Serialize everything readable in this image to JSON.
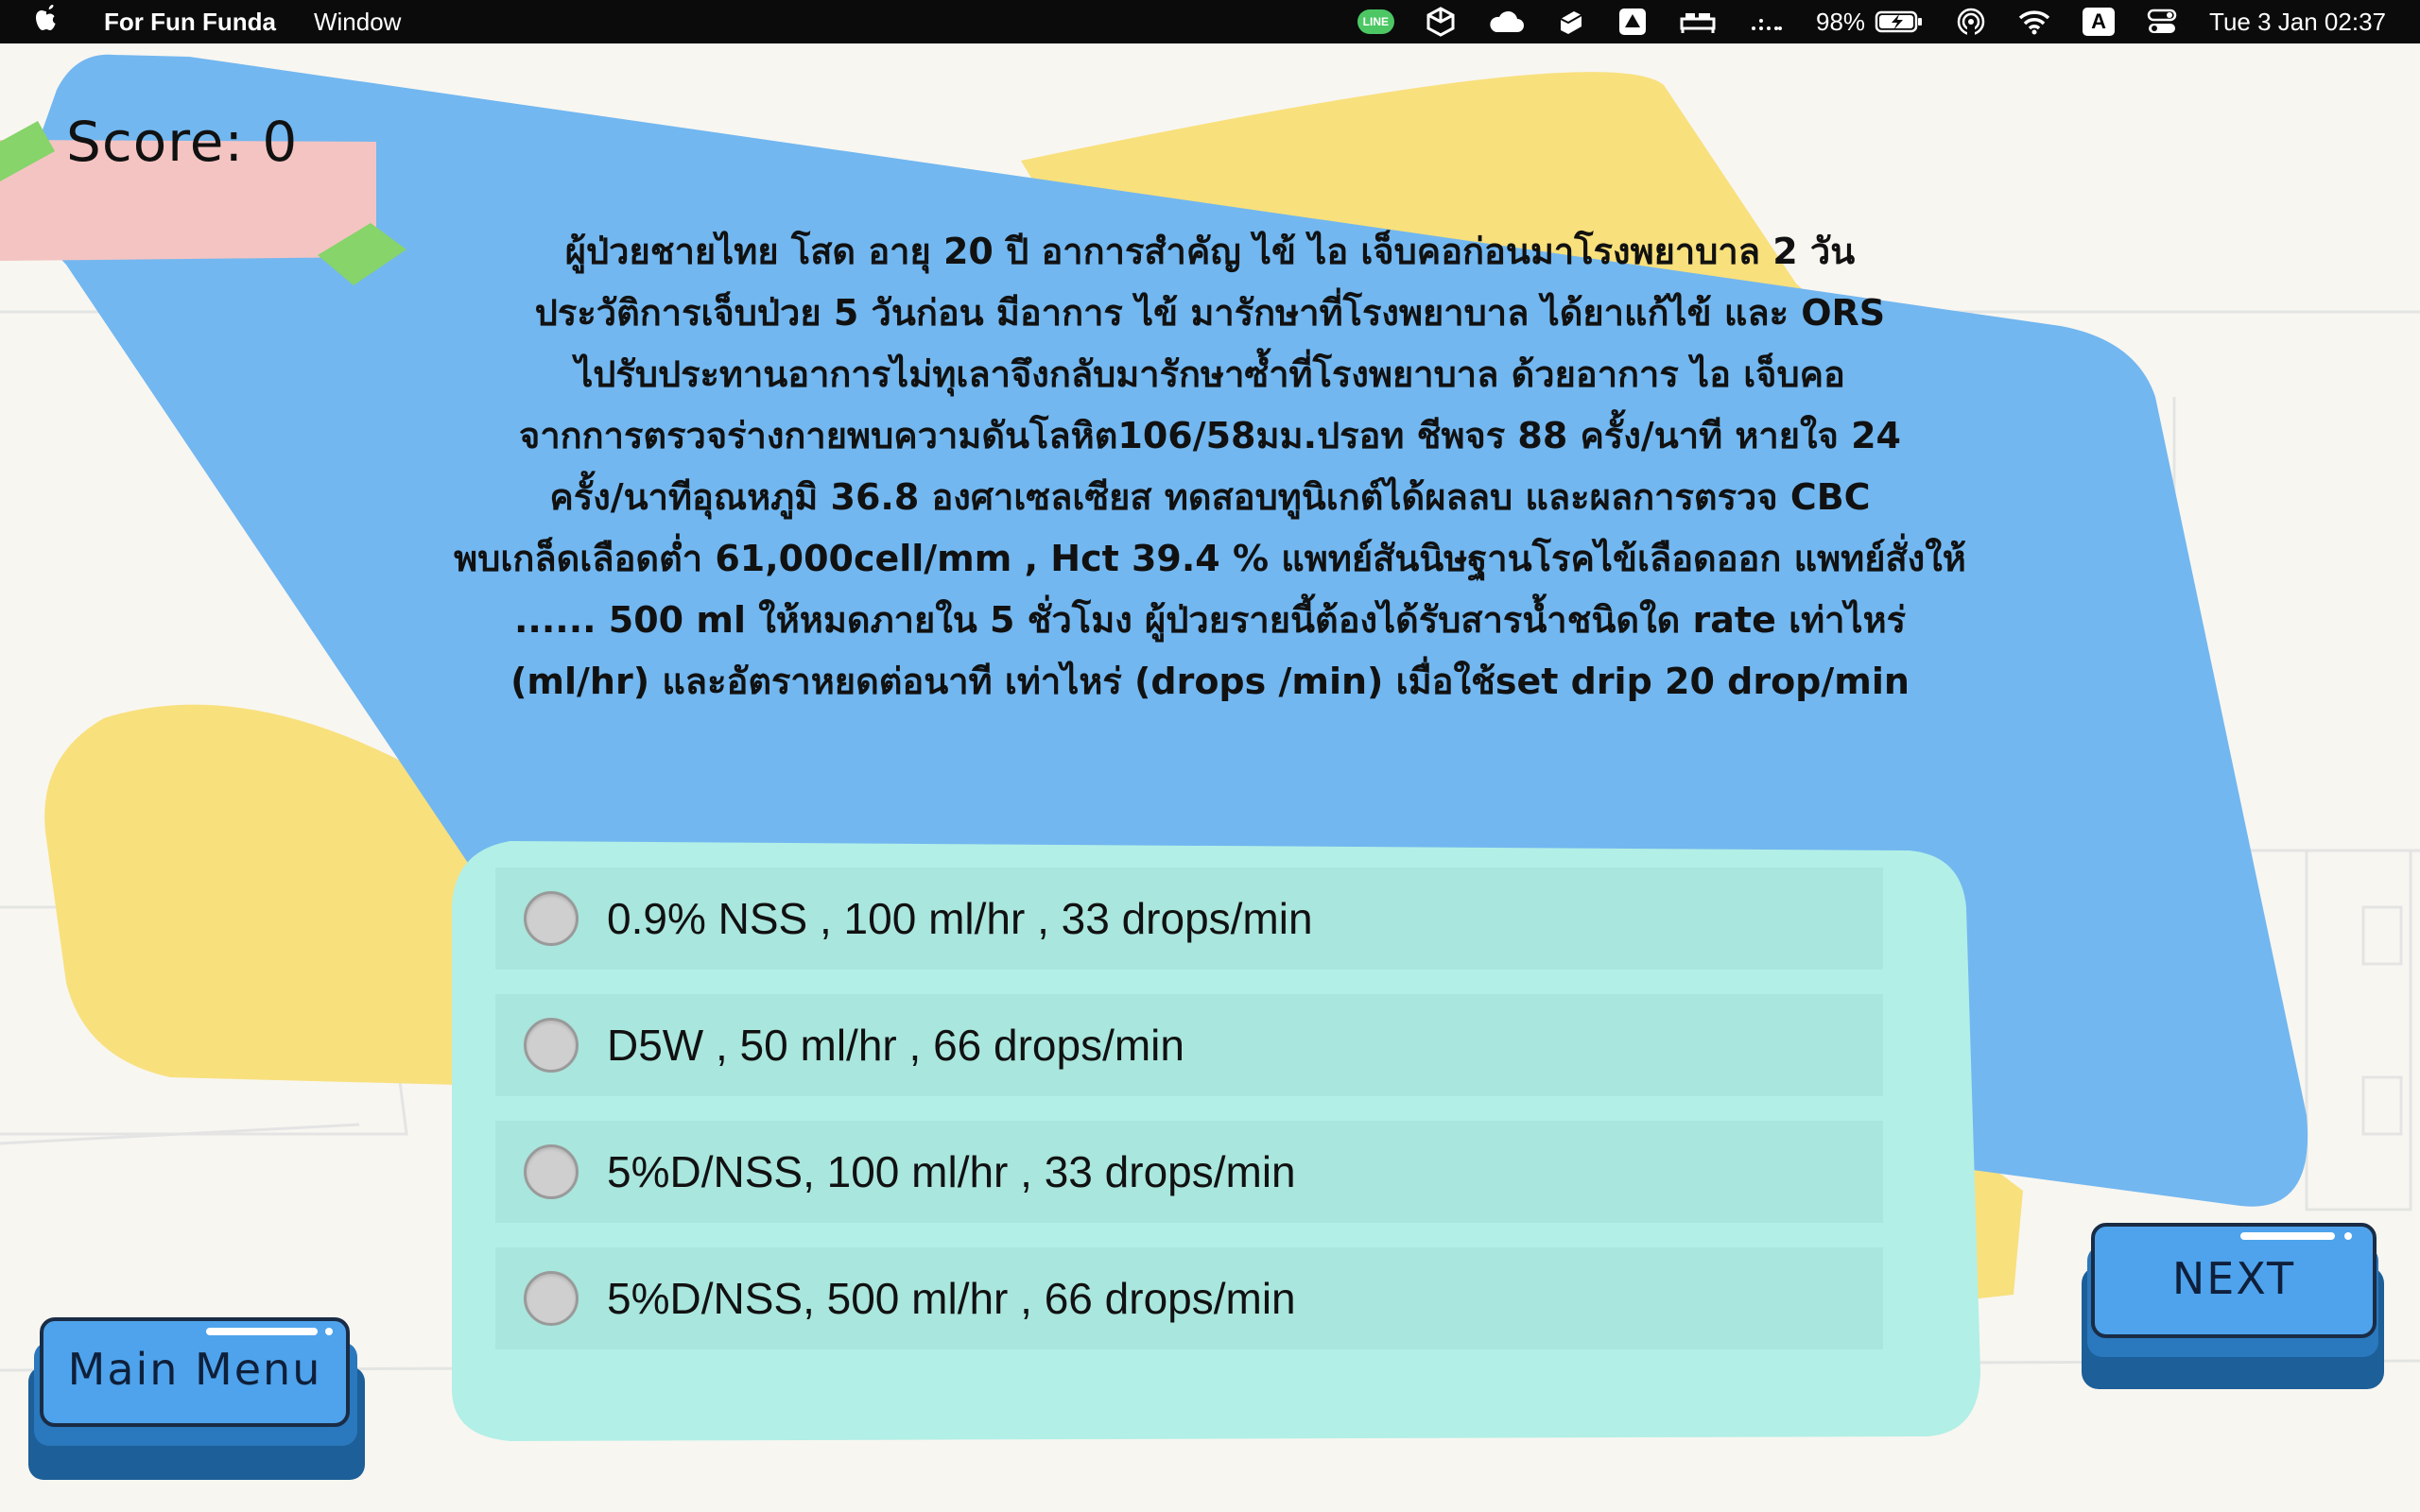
{
  "menubar": {
    "app_name": "For Fun Funda",
    "menu_window": "Window",
    "line_label": "LINE",
    "battery_percent": "98%",
    "input_source": "A",
    "clock": "Tue 3 Jan  02:37"
  },
  "game": {
    "score_text": "Score: 0",
    "question": "ผู้ป่วยชายไทย โสด อายุ 20 ปี อาการสำคัญ ไข้ ไอ เจ็บคอก่อนมาโรงพยาบาล 2 วัน\nประวัติการเจ็บป่วย 5 วันก่อน มีอาการ ไข้ มารักษาที่โรงพยาบาล ได้ยาแก้ไข้ และ ORS\nไปรับประทานอาการไม่ทุเลาจึงกลับมารักษาซ้ำที่โรงพยาบาล ด้วยอาการ ไอ เจ็บคอ\nจากการตรวจร่างกายพบความดันโลหิต106/58มม.ปรอท ชีพจร 88 ครั้ง/นาที หายใจ 24\nครั้ง/นาทีอุณหภูมิ 36.8 องศาเซลเซียส ทดสอบทูนิเกต์ได้ผลลบ และผลการตรวจ CBC\nพบเกล็ดเลือดต่ำ 61,000cell/mm , Hct 39.4 % แพทย์สันนิษฐานโรคไข้เลือดออก แพทย์สั่งให้\n......  500 ml ให้หมดภายใน 5 ชั่วโมง  ผู้ป่วยรายนี้ต้องได้รับสารน้ำชนิดใด rate เท่าไหร่\n(ml/hr) และอัตราหยดต่อนาที เท่าไหร่ (drops /min) เมื่อใช้set drip 20 drop/min",
    "options": [
      {
        "label": "0.9% NSS , 100 ml/hr ,  33 drops/min"
      },
      {
        "label": "D5W , 50 ml/hr , 66 drops/min"
      },
      {
        "label": "5%D/NSS, 100 ml/hr , 33 drops/min"
      },
      {
        "label": "5%D/NSS, 500 ml/hr , 66 drops/min"
      }
    ],
    "next_label": "NEXT",
    "main_menu_label": "Main  Menu"
  },
  "colors": {
    "blue_panel": "#72b7f0",
    "yellow_shape": "#f8e07d",
    "answer_panel": "#b2efe6",
    "option_row": "#a9e6dd",
    "score_tag": "#f4c4c2",
    "tape": "#86d46a",
    "button_blue": "#4ea3ec",
    "button_dark": "#1d5f98"
  }
}
